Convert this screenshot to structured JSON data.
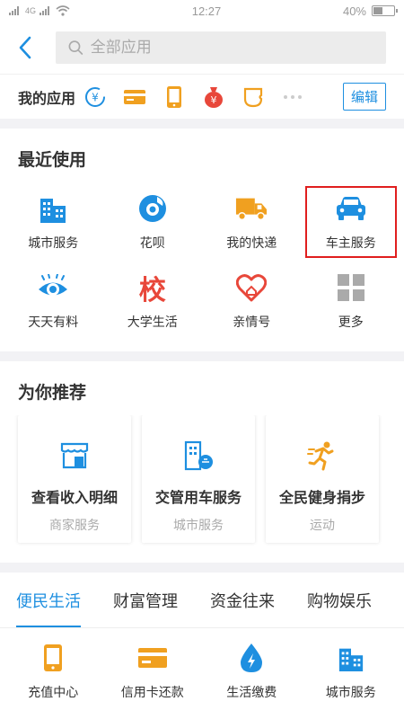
{
  "status": {
    "network": "4G",
    "time": "12:27",
    "battery_text": "40%",
    "battery_level": 0.4
  },
  "header": {
    "search_placeholder": "全部应用"
  },
  "my_apps": {
    "title": "我的应用",
    "icons": [
      "transfer-icon",
      "card-icon",
      "phone-icon",
      "money-bag-icon",
      "coupon-icon",
      "more-dots-icon"
    ],
    "edit_label": "编辑"
  },
  "recent": {
    "title": "最近使用",
    "items": [
      {
        "label": "城市服务",
        "icon": "city-building-icon",
        "color": "#1e8fe0"
      },
      {
        "label": "花呗",
        "icon": "huabei-icon",
        "color": "#1e8fe0"
      },
      {
        "label": "我的快递",
        "icon": "truck-icon",
        "color": "#f0a020"
      },
      {
        "label": "车主服务",
        "icon": "car-icon",
        "color": "#1e8fe0"
      },
      {
        "label": "天天有料",
        "icon": "eye-icon",
        "color": "#1e8fe0"
      },
      {
        "label": "大学生活",
        "icon": "school-icon",
        "color": "#e8473a"
      },
      {
        "label": "亲情号",
        "icon": "heart-home-icon",
        "color": "#e8473a"
      },
      {
        "label": "更多",
        "icon": "grid-more-icon",
        "color": "#999999"
      }
    ]
  },
  "recommend": {
    "title": "为你推荐",
    "cards": [
      {
        "title": "查看收入明细",
        "subtitle": "商家服务",
        "icon": "shop-icon"
      },
      {
        "title": "交管用车服务",
        "subtitle": "城市服务",
        "icon": "traffic-building-icon"
      },
      {
        "title": "全民健身捐步",
        "subtitle": "运动",
        "icon": "running-icon"
      }
    ]
  },
  "tabs": [
    "便民生活",
    "财富管理",
    "资金往来",
    "购物娱乐"
  ],
  "services": [
    {
      "label": "充值中心",
      "icon": "phone-icon"
    },
    {
      "label": "信用卡还款",
      "icon": "credit-card-icon"
    },
    {
      "label": "生活缴费",
      "icon": "drop-lightning-icon"
    },
    {
      "label": "城市服务",
      "icon": "city-building-icon"
    }
  ],
  "colors": {
    "accent": "#1e8fe0",
    "orange": "#f0a020",
    "red": "#e8473a",
    "highlight_border": "#e01e1e"
  }
}
